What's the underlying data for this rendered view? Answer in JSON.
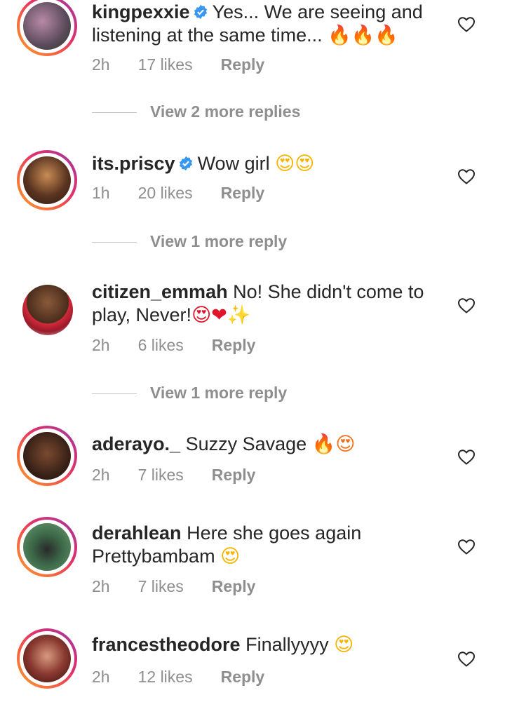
{
  "comments": [
    {
      "username": "kingpexxie",
      "verified": true,
      "text_line1": "Yes... We are seeing and",
      "text_line2": "listening at the same time...",
      "emojis": "🔥🔥🔥",
      "time": "2h",
      "likes": "17 likes",
      "reply": "Reply"
    },
    {
      "username": "its.priscy",
      "verified": true,
      "text_line1": "Wow girl",
      "emojis": "😍😍",
      "time": "1h",
      "likes": "20 likes",
      "reply": "Reply"
    },
    {
      "username": "citizen_emmah",
      "verified": false,
      "text_line1": "No! She didn't come to",
      "text_line2": "play, Never!",
      "emojis": "😍❤✨",
      "time": "2h",
      "likes": "6 likes",
      "reply": "Reply"
    },
    {
      "username": "aderayo._",
      "verified": false,
      "text_line1": "Suzzy Savage",
      "emojis": "🔥😍",
      "time": "2h",
      "likes": "7 likes",
      "reply": "Reply"
    },
    {
      "username": "derahlean",
      "verified": false,
      "text_line1": "Here she goes again",
      "text_line2": "Prettybambam",
      "emojis": "😍",
      "time": "2h",
      "likes": "7 likes",
      "reply": "Reply"
    },
    {
      "username": "francestheodore",
      "verified": false,
      "text_line1": "Finallyyyy",
      "emojis": "😍",
      "time": "2h",
      "likes": "12 likes",
      "reply": "Reply"
    }
  ],
  "view_more": [
    "View 2 more replies",
    "View 1 more reply",
    "View 1 more reply"
  ],
  "colors": {
    "text": "#262626",
    "secondary": "#8e8e8e",
    "verified": "#3897f0",
    "story_ring": "#e1306c"
  },
  "icons": {
    "like": "heart-outline-icon",
    "verified": "verified-badge-icon"
  }
}
